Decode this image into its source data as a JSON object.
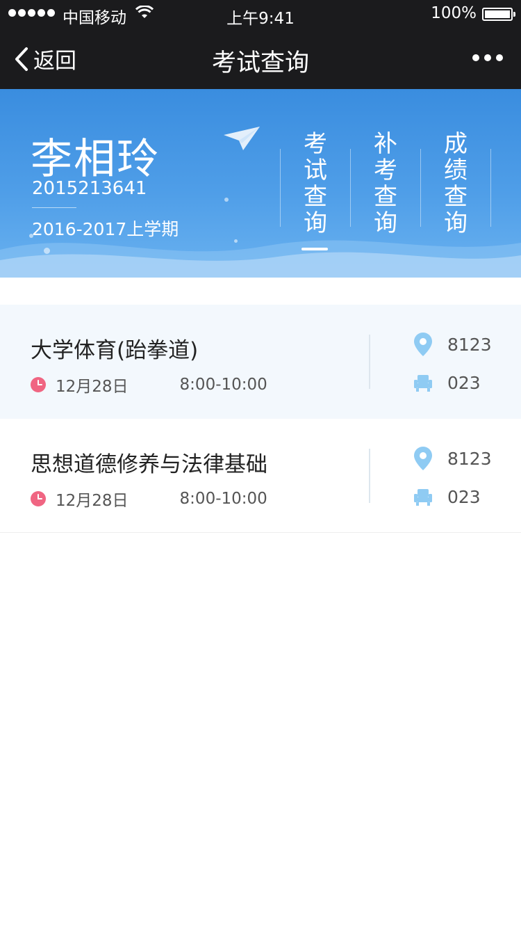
{
  "status_bar": {
    "carrier": "中国移动",
    "time": "上午9:41",
    "battery_pct": "100%"
  },
  "nav": {
    "back_label": "返回",
    "title": "考试查询"
  },
  "student": {
    "name": "李相玲",
    "id": "2015213641",
    "term": "2016-2017上学期"
  },
  "tabs": [
    {
      "label": "考试查询",
      "active": true
    },
    {
      "label": "补考查询",
      "active": false
    },
    {
      "label": "成绩查询",
      "active": false
    }
  ],
  "exams": [
    {
      "course": "大学体育(跆拳道)",
      "date": "12月28日",
      "time": "8:00-10:00",
      "room": "8123",
      "seat": "023"
    },
    {
      "course": "思想道德修养与法律基础",
      "date": "12月28日",
      "time": "8:00-10:00",
      "room": "8123",
      "seat": "023"
    }
  ],
  "colors": {
    "nav_bg": "#1b1b1d",
    "banner_blue": "#4f9ee8",
    "clock_red": "#f06582",
    "icon_blue": "#8fcbf3"
  }
}
